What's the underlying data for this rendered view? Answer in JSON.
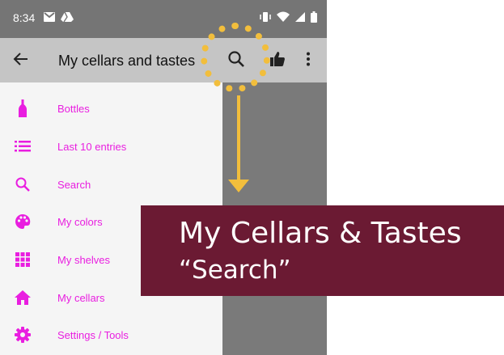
{
  "status_bar": {
    "time": "8:34",
    "left_icons": [
      "gmail-icon",
      "drive-icon"
    ],
    "right_icons": [
      "vibrate-icon",
      "wifi-icon",
      "signal-icon",
      "battery-icon"
    ]
  },
  "app_bar": {
    "title": "My cellars and tastes",
    "back_icon": "arrow-back-icon",
    "actions": [
      "search-icon",
      "thumb-up-icon",
      "more-vert-icon"
    ]
  },
  "drawer": {
    "items": [
      {
        "label": "Bottles",
        "icon": "bottle-icon"
      },
      {
        "label": "Last 10 entries",
        "icon": "list-icon"
      },
      {
        "label": "Search",
        "icon": "search-icon"
      },
      {
        "label": "My colors",
        "icon": "palette-icon"
      },
      {
        "label": "My shelves",
        "icon": "grid-icon"
      },
      {
        "label": "My cellars",
        "icon": "home-icon"
      },
      {
        "label": "Settings / Tools",
        "icon": "gear-icon"
      }
    ]
  },
  "callout": {
    "title": "My Cellars & Tastes",
    "subtitle": "“Search”"
  },
  "colors": {
    "accent": "#e91ee0",
    "highlight": "#f2be3c",
    "banner": "#6b1a33",
    "app_bar": "#c5c5c5",
    "status_bar": "#757575"
  }
}
